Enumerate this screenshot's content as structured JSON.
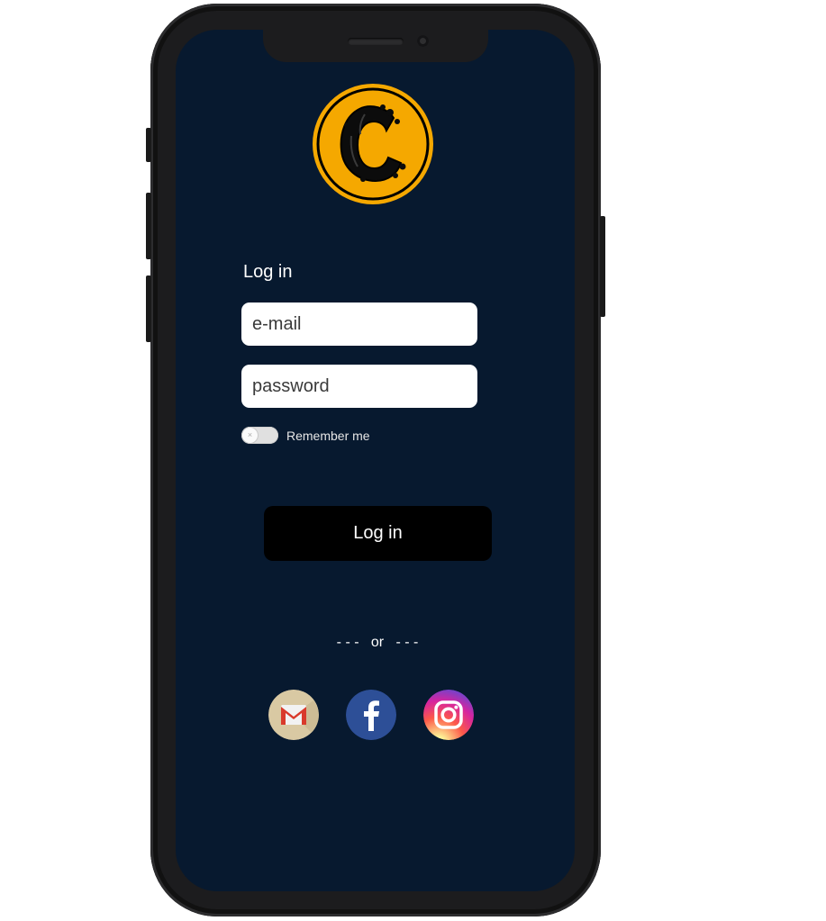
{
  "login": {
    "title": "Log in",
    "email_placeholder": "e-mail",
    "password_placeholder": "password",
    "remember_label": "Remember me",
    "remember_checked": false,
    "submit_label": "Log in",
    "divider_text": "- - -   or   - - -"
  },
  "social": [
    {
      "icon": "gmail-icon"
    },
    {
      "icon": "facebook-icon"
    },
    {
      "icon": "instagram-icon"
    }
  ],
  "colors": {
    "screen_bg": "#07192f",
    "logo_gold": "#f5a800",
    "button_bg": "#000000",
    "facebook": "#2d4f97",
    "gmail_bg": "#d9c9a3",
    "gmail_red": "#d93a2b"
  }
}
